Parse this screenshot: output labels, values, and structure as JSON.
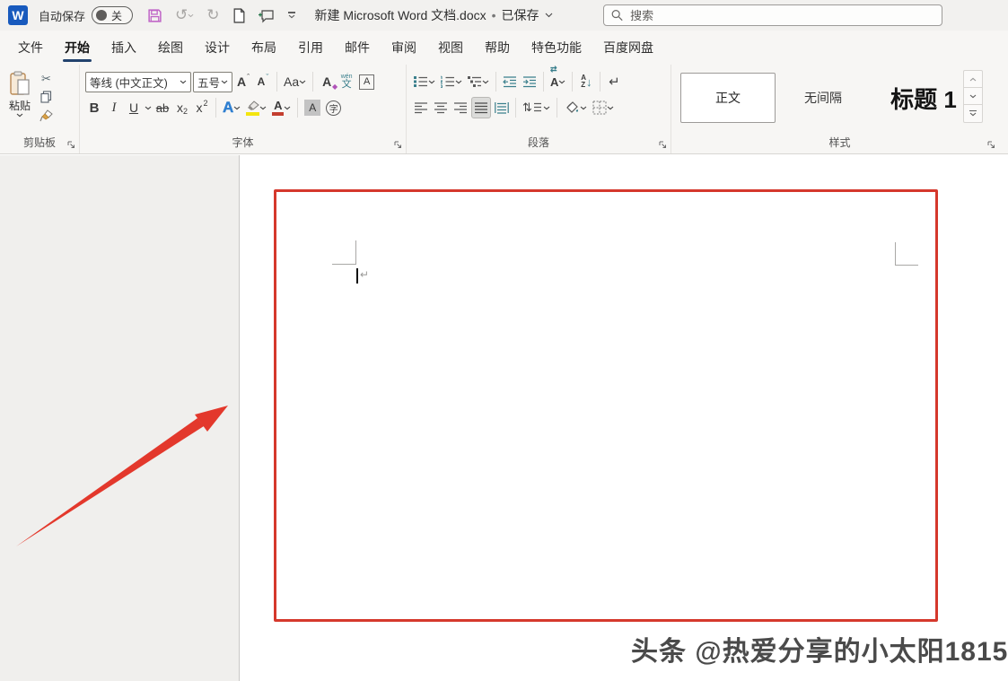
{
  "titlebar": {
    "app_letter": "W",
    "autosave_label": "自动保存",
    "autosave_state": "关",
    "doc_title": "新建 Microsoft Word 文档.docx",
    "separator": "•",
    "save_status": "已保存",
    "search_placeholder": "搜索"
  },
  "tabs": [
    "文件",
    "开始",
    "插入",
    "绘图",
    "设计",
    "布局",
    "引用",
    "邮件",
    "审阅",
    "视图",
    "帮助",
    "特色功能",
    "百度网盘"
  ],
  "ribbon": {
    "clipboard": {
      "paste_label": "粘贴",
      "group_label": "剪贴板"
    },
    "font": {
      "font_name": "等线 (中文正文)",
      "font_size": "五号",
      "group_label": "字体"
    },
    "paragraph": {
      "group_label": "段落"
    },
    "styles": {
      "normal": "正文",
      "no_spacing": "无间隔",
      "heading1": "标题 1",
      "group_label": "样式"
    }
  },
  "glyphs": {
    "undo": "↺",
    "redo": "↻",
    "grow_font": "A",
    "caret_up": "ˆ",
    "shrink_font": "A",
    "caret_down": "ˇ",
    "change_case": "Aa",
    "clear_format": "A",
    "eraser": "◆",
    "phonetic_top": "wén",
    "phonetic_bottom": "文",
    "char_border": "A",
    "bold": "B",
    "italic": "I",
    "underline": "U",
    "strikethrough": "ab",
    "subscript_base": "x",
    "subscript_mark": "2",
    "superscript_base": "x",
    "superscript_mark": "2",
    "text_effects": "A",
    "font_color": "A",
    "shading_a": "A",
    "enclose_char": "字",
    "scissors": "✂",
    "asian_layout": "A",
    "asian_arrows": "⇄",
    "sort_a": "A",
    "sort_z": "Z",
    "sort_arrow": "↓",
    "show_marks": "↵",
    "line_spacing": "⇅",
    "paragraph_mark": "↵"
  },
  "watermark": "头条 @热爱分享的小太阳1815"
}
